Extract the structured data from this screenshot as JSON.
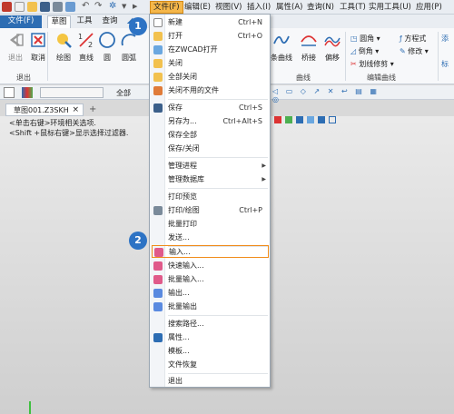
{
  "menubar": {
    "items": [
      "文件(F)",
      "编辑(E)",
      "视图(V)",
      "插入(I)",
      "属性(A)",
      "查询(N)",
      "工具(T)",
      "实用工具(U)",
      "应用(P)"
    ]
  },
  "tabs": {
    "file": "文件(F)",
    "sketch": "草图",
    "tools": "工具",
    "query": "查询"
  },
  "ribbon": {
    "buttons": [
      "退出",
      "取消",
      "绘图",
      "直线",
      "圆",
      "圆弧"
    ],
    "group_exit": "退出",
    "curve_buttons": [
      "条曲线",
      "桥接",
      "偏移"
    ],
    "group_curve": "曲线",
    "edit_items": [
      "圆角",
      "倒角",
      "划线修剪"
    ],
    "edit_items_right": [
      "方程式",
      "修改"
    ],
    "group_edit": "编辑曲线",
    "right_partial": [
      "添",
      "标"
    ]
  },
  "toolbar2": {
    "select_all": "全部"
  },
  "hint": {
    "line1": "<单击右键>环境相关选项.",
    "line2": "<Shift +鼠标右键>显示选择过滤器."
  },
  "doc_tab": {
    "name": "草图001.Z3SKH",
    "close": "×",
    "add": "+"
  },
  "file_menu": {
    "items": [
      {
        "label": "新建",
        "shortcut": "Ctrl+N"
      },
      {
        "label": "打开",
        "shortcut": "Ctrl+O"
      },
      {
        "label": "在ZWCAD打开",
        "shortcut": ""
      },
      {
        "label": "关闭",
        "shortcut": ""
      },
      {
        "label": "全部关闭",
        "shortcut": ""
      },
      {
        "label": "关闭不用的文件",
        "shortcut": ""
      },
      {
        "label": "保存",
        "shortcut": "Ctrl+S"
      },
      {
        "label": "另存为...",
        "shortcut": "Ctrl+Alt+S"
      },
      {
        "label": "保存全部",
        "shortcut": ""
      },
      {
        "label": "保存/关闭",
        "shortcut": ""
      },
      {
        "label": "管理进程",
        "shortcut": ""
      },
      {
        "label": "管理数据库",
        "shortcut": ""
      },
      {
        "label": "打印预览",
        "shortcut": ""
      },
      {
        "label": "打印/绘图",
        "shortcut": "Ctrl+P"
      },
      {
        "label": "批量打印",
        "shortcut": ""
      },
      {
        "label": "发送...",
        "shortcut": ""
      },
      {
        "label": "输入...",
        "shortcut": ""
      },
      {
        "label": "快速输入...",
        "shortcut": ""
      },
      {
        "label": "批量输入...",
        "shortcut": ""
      },
      {
        "label": "输出...",
        "shortcut": ""
      },
      {
        "label": "批量输出",
        "shortcut": ""
      },
      {
        "label": "搜索路径...",
        "shortcut": ""
      },
      {
        "label": "属性...",
        "shortcut": ""
      },
      {
        "label": "模板...",
        "shortcut": ""
      },
      {
        "label": "文件恢复",
        "shortcut": ""
      },
      {
        "label": "退出",
        "shortcut": ""
      }
    ]
  },
  "badges": [
    "1",
    "2"
  ],
  "colors": {
    "accent": "#2d6db3",
    "highlight": "#f08c1a",
    "menubar_active": "#f5b74a"
  }
}
